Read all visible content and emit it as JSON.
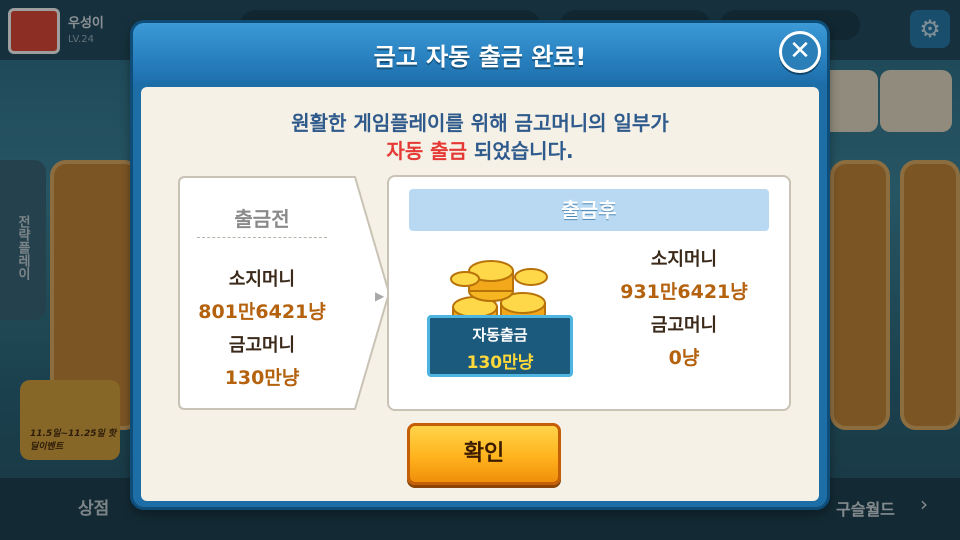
{
  "background": {
    "user_name": "우성이",
    "level_text": "LV.24",
    "left_tab_label": "전략플레이",
    "event_text": "11.5일~11.25일 핫딜이벤트",
    "shop_label": "상점",
    "world_label": "구슬월드",
    "world_arrow": "›",
    "gear_glyph": "⚙"
  },
  "dialog": {
    "title": "금고 자동 출금 완료!",
    "close_glyph": "✕",
    "message_line1": "원활한 게임플레이를 위해 금고머니의 일부가",
    "message_highlight": "자동 출금",
    "message_line2_rest": " 되었습니다.",
    "before": {
      "title": "출금전",
      "holding_label": "소지머니",
      "holding_value": "801만6421냥",
      "vault_label": "금고머니",
      "vault_value": "130만냥"
    },
    "after": {
      "title": "출금후",
      "holding_label": "소지머니",
      "holding_value": "931만6421냥",
      "vault_label": "금고머니",
      "vault_value": "0냥",
      "auto_label": "자동출금",
      "auto_value": "130만냥"
    },
    "confirm_label": "확인"
  },
  "colors": {
    "header_blue": "#2a82c1",
    "highlight_red": "#e53935",
    "value_orange": "#b4620e",
    "confirm_yellow": "#ffb31d"
  }
}
